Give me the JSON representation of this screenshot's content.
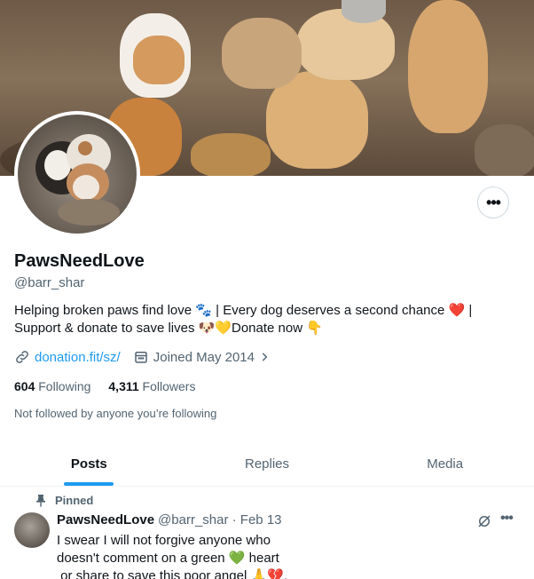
{
  "profile": {
    "name": "PawsNeedLove",
    "handle": "@barr_shar",
    "bio_line1": "Helping broken paws find love 🐾 | Every dog deserves a second chance ",
    "bio_heart": "❤️",
    "bio_line1_end": " |",
    "bio_line2": "Support & donate to save lives 🐶💛Donate now 👇",
    "website": "donation.fit/sz/",
    "joined": "Joined May 2014",
    "following_count": "604",
    "following_label": "Following",
    "followers_count": "4,311",
    "followers_label": "Followers",
    "not_followed": "Not followed by anyone you’re following",
    "more_label": "•••"
  },
  "tabs": [
    {
      "label": "Posts"
    },
    {
      "label": "Replies"
    },
    {
      "label": "Media"
    }
  ],
  "post": {
    "pinned_label": "Pinned",
    "author_name": "PawsNeedLove",
    "author_meta": "@barr_shar · Feb 13",
    "text_line1": "I swear I will not forgive anyone who",
    "text_line2": "doesn't comment on a green 💚 heart",
    "text_line3": " or share to save this poor angel 🙏💔.",
    "more_label": "•••"
  },
  "colors": {
    "accent": "#1d9bf0",
    "text_primary": "#0f1419",
    "text_secondary": "#536471",
    "border": "#eff3f4"
  }
}
